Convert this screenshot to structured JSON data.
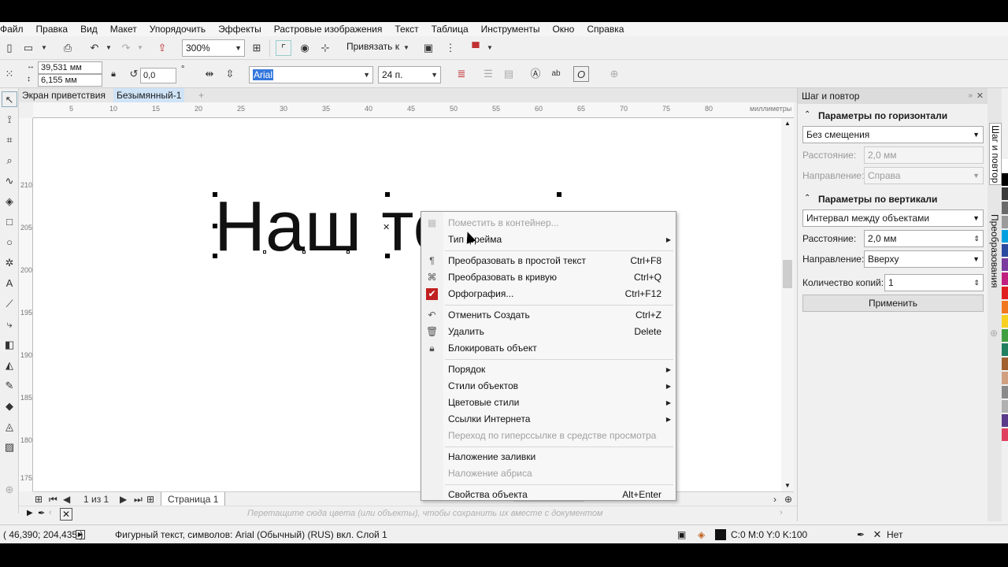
{
  "menu": [
    "Файл",
    "Правка",
    "Вид",
    "Макет",
    "Упорядочить",
    "Эффекты",
    "Растровые изображения",
    "Текст",
    "Таблица",
    "Инструменты",
    "Окно",
    "Справка"
  ],
  "toolbar": {
    "zoom": "300%",
    "snap_label": "Привязать к"
  },
  "propbar": {
    "width": "39,531 мм",
    "height": "6,155 мм",
    "angle": "0,0",
    "angle_unit": "°",
    "font": "Arial",
    "size": "24 п."
  },
  "tabs": [
    "Экран приветствия",
    "Безымянный-1"
  ],
  "ruler_units": "миллиметры",
  "hruler_ticks": [
    "5",
    "10",
    "15",
    "20",
    "25",
    "30",
    "35",
    "40",
    "45",
    "50",
    "55",
    "60",
    "65",
    "70",
    "75",
    "80"
  ],
  "vruler_ticks": [
    "210",
    "205",
    "200",
    "195",
    "190",
    "185",
    "180",
    "175"
  ],
  "canvas_text": "Наш текст",
  "context_menu": [
    {
      "label": "Поместить в контейнер...",
      "disabled": true,
      "icon": "container-icon"
    },
    {
      "label": "Тип фрейма",
      "submenu": true
    },
    {
      "sep": true
    },
    {
      "label": "Преобразовать в простой текст",
      "shortcut": "Ctrl+F8",
      "icon": "paragraph-text-icon"
    },
    {
      "label": "Преобразовать в кривую",
      "shortcut": "Ctrl+Q",
      "icon": "curve-icon"
    },
    {
      "label": "Орфография...",
      "shortcut": "Ctrl+F12",
      "icon": "spellcheck-icon"
    },
    {
      "sep": true
    },
    {
      "label": "Отменить Создать",
      "shortcut": "Ctrl+Z",
      "icon": "undo-icon"
    },
    {
      "label": "Удалить",
      "shortcut": "Delete",
      "icon": "trash-icon"
    },
    {
      "label": "Блокировать объект",
      "icon": "lock-icon"
    },
    {
      "sep": true
    },
    {
      "label": "Порядок",
      "submenu": true
    },
    {
      "label": "Стили объектов",
      "submenu": true
    },
    {
      "label": "Цветовые стили",
      "submenu": true
    },
    {
      "label": "Ссылки Интернета",
      "submenu": true
    },
    {
      "label": "Переход по гиперссылке в средстве просмотра",
      "disabled": true
    },
    {
      "sep": true
    },
    {
      "label": "Наложение заливки"
    },
    {
      "label": "Наложение абриса",
      "disabled": true
    },
    {
      "sep": true
    },
    {
      "label": "Свойства объекта",
      "shortcut": "Alt+Enter"
    }
  ],
  "docker": {
    "title": "Шаг и повтор",
    "horizontal_section": "Параметры по горизонтали",
    "h_mode": "Без смещения",
    "h_distance_label": "Расстояние:",
    "h_distance": "2,0 мм",
    "h_direction_label": "Направление:",
    "h_direction": "Справа",
    "vertical_section": "Параметры по вертикали",
    "v_mode": "Интервал между объектами",
    "v_distance_label": "Расстояние:",
    "v_distance": "2,0 мм",
    "v_direction_label": "Направление:",
    "v_direction": "Вверху",
    "copies_label": "Количество копий:",
    "copies": "1",
    "apply": "Применить"
  },
  "side_tabs": [
    "Шаг и повтор",
    "Преобразования"
  ],
  "pagebar": {
    "page_count": "1 из 1",
    "page_tab": "Страница 1"
  },
  "color_hint": "Перетащите сюда цвета (или объекты), чтобы сохранить их вместе с документом",
  "status": {
    "coords": "( 46,390; 204,435 )",
    "info": "Фигурный текст, символов: Arial (Обычный) (RUS) вкл. Слой 1",
    "fill": "C:0 M:0 Y:0 K:100",
    "outline": "Нет"
  },
  "palette": [
    "#ffffff",
    "#000000",
    "#3a3a3a",
    "#6a6a6a",
    "#9a9a9a",
    "#00a0e0",
    "#2a4aa0",
    "#7a3aa0",
    "#c02080",
    "#e02020",
    "#f07820",
    "#f8d020",
    "#40a040",
    "#208060",
    "#a06030",
    "#d0a080",
    "#8a8a8a",
    "#b0b0b0",
    "#5a3a8a",
    "#e04060"
  ]
}
